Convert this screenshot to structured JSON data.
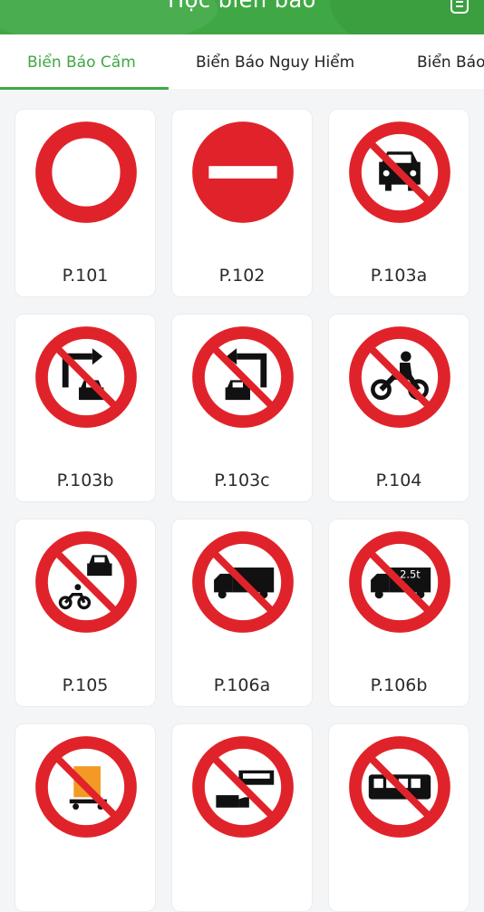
{
  "header": {
    "title": "Học biển báo"
  },
  "tabs": [
    {
      "label": "Biển Báo Cấm",
      "active": true
    },
    {
      "label": "Biển Báo Nguy Hiểm",
      "active": false
    },
    {
      "label": "Biển Báo",
      "active": false
    }
  ],
  "signs": [
    {
      "code": "P.101",
      "icon": "no-vehicles-sign-icon"
    },
    {
      "code": "P.102",
      "icon": "no-entry-sign-icon"
    },
    {
      "code": "P.103a",
      "icon": "no-cars-sign-icon"
    },
    {
      "code": "P.103b",
      "icon": "no-cars-turn-right-sign-icon"
    },
    {
      "code": "P.103c",
      "icon": "no-cars-turn-left-sign-icon"
    },
    {
      "code": "P.104",
      "icon": "no-motorcycles-sign-icon"
    },
    {
      "code": "P.105",
      "icon": "no-cars-and-motorcycles-sign-icon"
    },
    {
      "code": "P.106a",
      "icon": "no-trucks-sign-icon"
    },
    {
      "code": "P.106b",
      "icon": "no-trucks-over-weight-sign-icon",
      "weight_label": "2.5t"
    },
    {
      "code": "",
      "icon": "no-hazardous-cargo-sign-icon"
    },
    {
      "code": "",
      "icon": "no-truck-and-bus-sign-icon"
    },
    {
      "code": "",
      "icon": "no-buses-sign-icon"
    }
  ],
  "colors": {
    "brand_green": "#3fa844",
    "sign_red": "#e0232a"
  }
}
